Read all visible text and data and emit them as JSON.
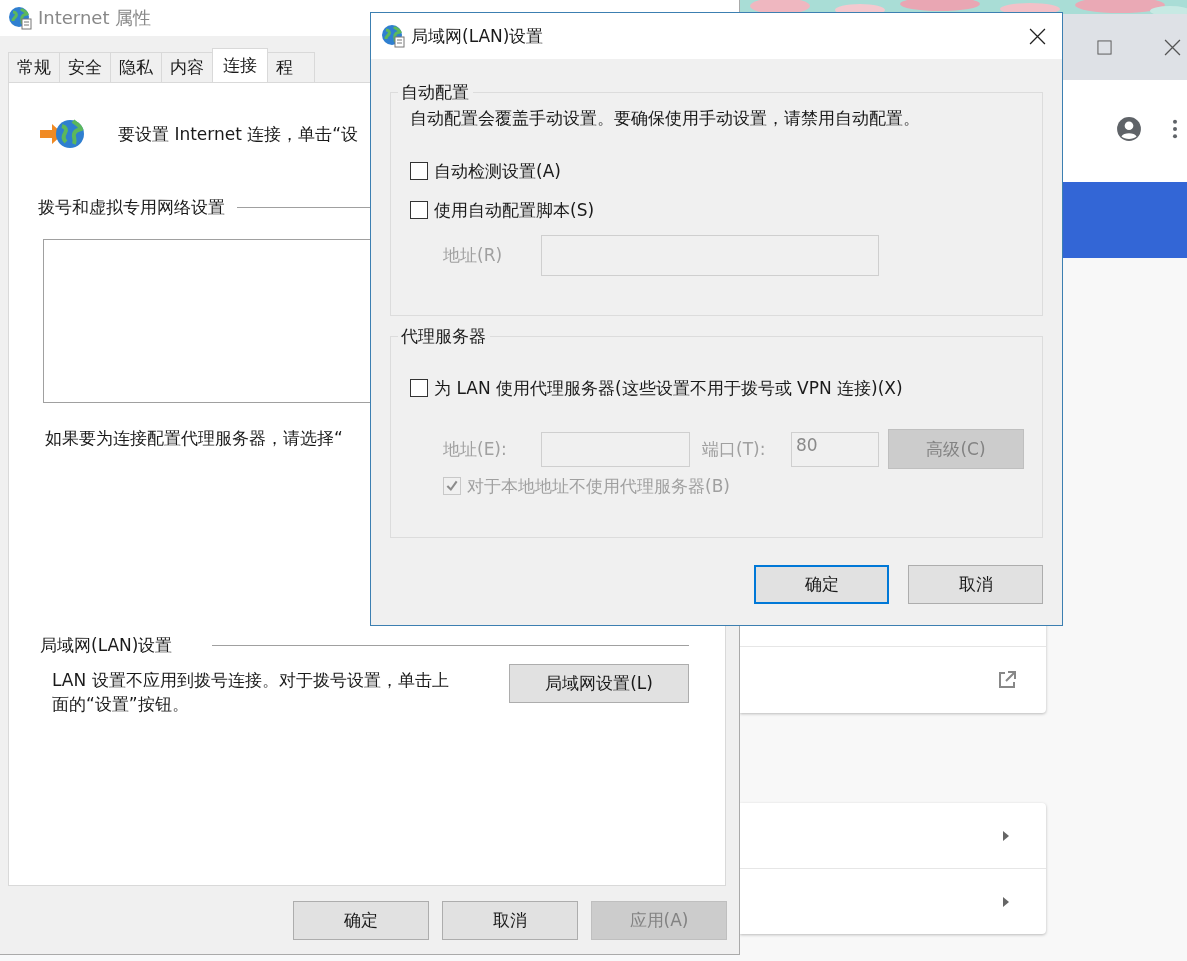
{
  "internet_window": {
    "title": "Internet 属性",
    "tabs": [
      {
        "label": "常规",
        "selected": false
      },
      {
        "label": "安全",
        "selected": false
      },
      {
        "label": "隐私",
        "selected": false
      },
      {
        "label": "内容",
        "selected": false
      },
      {
        "label": "连接",
        "selected": true
      },
      {
        "label": "程",
        "selected": false
      }
    ],
    "intro_text": "要设置 Internet 连接，单击“设",
    "dialup_heading": "拨号和虚拟专用网络设置",
    "proxy_hint": "如果要为连接配置代理服务器，请选择“",
    "lan_heading": "局域网(LAN)设置",
    "lan_text": "LAN 设置不应用到拨号连接。对于拨号设置，单击上面的“设置”按钮。",
    "lan_button": "局域网设置(L)",
    "buttons": [
      {
        "label": "确定",
        "disabled": false
      },
      {
        "label": "取消",
        "disabled": false
      },
      {
        "label": "应用(A)",
        "disabled": true
      }
    ]
  },
  "lan_dialog": {
    "title": "局域网(LAN)设置",
    "auto_config": {
      "heading": "自动配置",
      "description": "自动配置会覆盖手动设置。要确保使用手动设置，请禁用自动配置。",
      "options": [
        {
          "label": "自动检测设置(A)",
          "checked": false
        },
        {
          "label": "使用自动配置脚本(S)",
          "checked": false
        }
      ],
      "address_label": "地址(R)",
      "address_disabled": true
    },
    "proxy": {
      "heading": "代理服务器",
      "option": {
        "label": "为 LAN 使用代理服务器(这些设置不用于拨号或 VPN 连接)(X)",
        "checked": false
      },
      "address_label": "地址(E):",
      "port_label": "端口(T):",
      "port_value": "80",
      "fields_disabled": true,
      "advanced_button": {
        "label": "高级(C)",
        "disabled": true
      },
      "bypass": {
        "label": "对于本地地址不使用代理服务器(B)",
        "checked": true,
        "disabled": true
      }
    },
    "buttons": [
      {
        "label": "确定",
        "default": true
      },
      {
        "label": "取消",
        "default": false
      }
    ]
  }
}
